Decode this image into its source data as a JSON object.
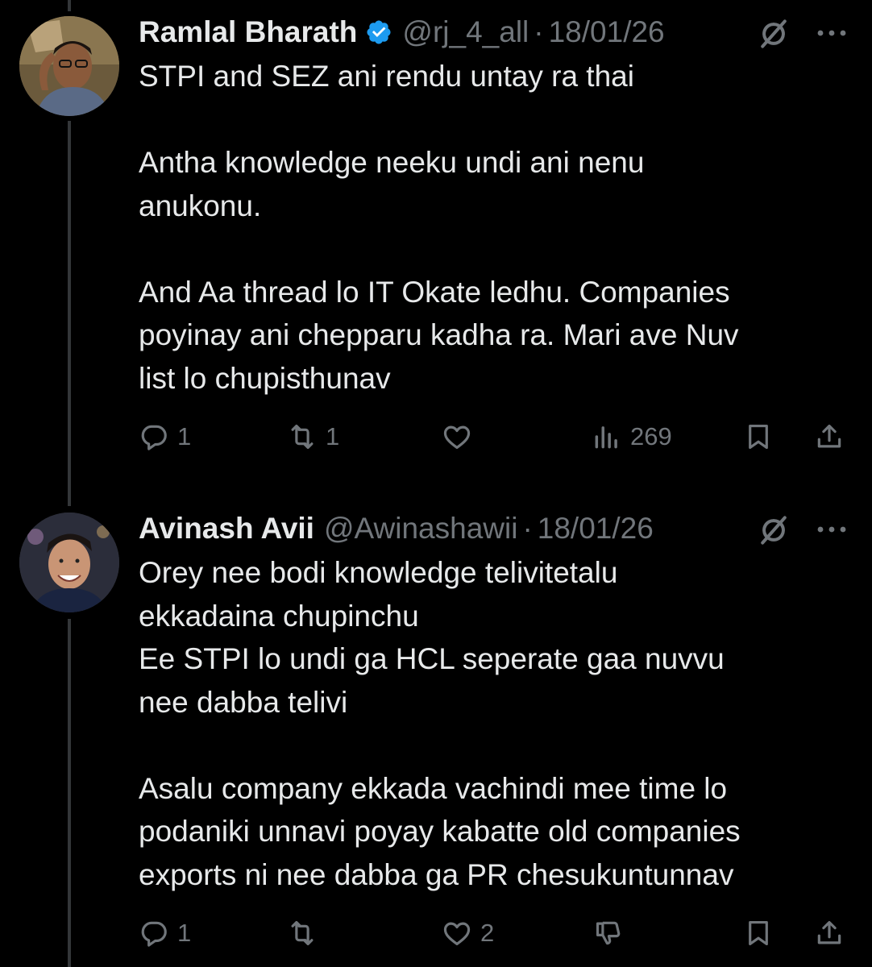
{
  "tweets": [
    {
      "author_name": "Ramlal Bharath",
      "verified": true,
      "handle": "@rj_4_all",
      "separator": "·",
      "date": "18/01/26",
      "paragraphs": [
        [
          "STPI and SEZ ani rendu untay ra thai"
        ],
        [
          "Antha knowledge neeku undi ani nenu",
          "anukonu."
        ],
        [
          "And Aa thread lo IT Okate ledhu. Companies",
          "poyinay ani chepparu kadha ra. Mari ave Nuv",
          "list lo chupisthunav"
        ]
      ],
      "actions": {
        "replies": "1",
        "reposts": "1",
        "likes": "",
        "views": "269"
      }
    },
    {
      "author_name": "Avinash Avii",
      "verified": false,
      "handle": "@Awinashawii",
      "separator": "·",
      "date": "18/01/26",
      "paragraphs": [
        [
          "Orey nee bodi knowledge telivitetalu",
          "ekkadaina chupinchu",
          "Ee STPI lo undi ga HCL seperate gaa nuvvu",
          "nee dabba telivi"
        ],
        [
          "Asalu company ekkada vachindi mee time lo",
          "podaniki unnavi poyay kabatte old companies",
          "exports ni nee dabba ga PR chesukuntunnav"
        ]
      ],
      "actions": {
        "replies": "1",
        "reposts": "",
        "likes": "2"
      }
    }
  ],
  "icons": [
    "grok-icon",
    "more-icon",
    "reply-icon",
    "repost-icon",
    "like-icon",
    "views-icon",
    "bookmark-icon",
    "share-icon",
    "downvote-icon",
    "verified-badge-icon"
  ],
  "colors": {
    "background": "#000000",
    "text": "#e7e9ea",
    "muted": "#71767b",
    "verified": "#1d9bf0",
    "thread_line": "#333639"
  }
}
